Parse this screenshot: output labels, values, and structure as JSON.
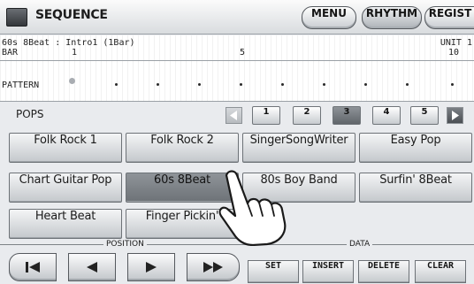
{
  "title": "SEQUENCE",
  "header_buttons": {
    "menu": "MENU",
    "rhythm": "RHYTHM",
    "regist": "REGIST"
  },
  "info": {
    "song": "60s 8Beat : Intro1 (1Bar)",
    "unit": "UNIT 1",
    "bar_label": "BAR",
    "bar_marks": [
      "1",
      "5",
      "10"
    ],
    "pattern_label": "PATTERN"
  },
  "category": "POPS",
  "pages": [
    "1",
    "2",
    "3",
    "4",
    "5"
  ],
  "active_page": "3",
  "voices": [
    "Folk Rock 1",
    "Folk Rock 2",
    "SingerSongWriter",
    "Easy Pop",
    "Chart Guitar Pop",
    "60s 8Beat",
    "80s Boy Band",
    "Surfin' 8Beat",
    "Heart Beat",
    "Finger Pickin'"
  ],
  "selected_voice": "60s 8Beat",
  "bottom": {
    "position_label": "POSITION",
    "data_label": "DATA",
    "data_buttons": [
      "SET",
      "INSERT",
      "DELETE",
      "CLEAR"
    ]
  },
  "icons": [
    "skip-to-start-icon",
    "back-icon",
    "play-icon",
    "fast-forward-icon",
    "pointing-hand-icon",
    "left-arrow-icon",
    "right-arrow-icon"
  ]
}
